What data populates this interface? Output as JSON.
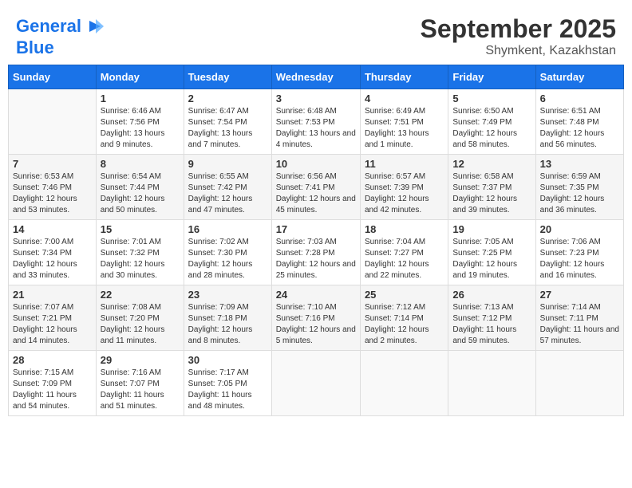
{
  "header": {
    "logo_line1": "General",
    "logo_line2": "Blue",
    "month": "September 2025",
    "location": "Shymkent, Kazakhstan"
  },
  "weekdays": [
    "Sunday",
    "Monday",
    "Tuesday",
    "Wednesday",
    "Thursday",
    "Friday",
    "Saturday"
  ],
  "weeks": [
    [
      {
        "day": "",
        "sunrise": "",
        "sunset": "",
        "daylight": ""
      },
      {
        "day": "1",
        "sunrise": "Sunrise: 6:46 AM",
        "sunset": "Sunset: 7:56 PM",
        "daylight": "Daylight: 13 hours and 9 minutes."
      },
      {
        "day": "2",
        "sunrise": "Sunrise: 6:47 AM",
        "sunset": "Sunset: 7:54 PM",
        "daylight": "Daylight: 13 hours and 7 minutes."
      },
      {
        "day": "3",
        "sunrise": "Sunrise: 6:48 AM",
        "sunset": "Sunset: 7:53 PM",
        "daylight": "Daylight: 13 hours and 4 minutes."
      },
      {
        "day": "4",
        "sunrise": "Sunrise: 6:49 AM",
        "sunset": "Sunset: 7:51 PM",
        "daylight": "Daylight: 13 hours and 1 minute."
      },
      {
        "day": "5",
        "sunrise": "Sunrise: 6:50 AM",
        "sunset": "Sunset: 7:49 PM",
        "daylight": "Daylight: 12 hours and 58 minutes."
      },
      {
        "day": "6",
        "sunrise": "Sunrise: 6:51 AM",
        "sunset": "Sunset: 7:48 PM",
        "daylight": "Daylight: 12 hours and 56 minutes."
      }
    ],
    [
      {
        "day": "7",
        "sunrise": "Sunrise: 6:53 AM",
        "sunset": "Sunset: 7:46 PM",
        "daylight": "Daylight: 12 hours and 53 minutes."
      },
      {
        "day": "8",
        "sunrise": "Sunrise: 6:54 AM",
        "sunset": "Sunset: 7:44 PM",
        "daylight": "Daylight: 12 hours and 50 minutes."
      },
      {
        "day": "9",
        "sunrise": "Sunrise: 6:55 AM",
        "sunset": "Sunset: 7:42 PM",
        "daylight": "Daylight: 12 hours and 47 minutes."
      },
      {
        "day": "10",
        "sunrise": "Sunrise: 6:56 AM",
        "sunset": "Sunset: 7:41 PM",
        "daylight": "Daylight: 12 hours and 45 minutes."
      },
      {
        "day": "11",
        "sunrise": "Sunrise: 6:57 AM",
        "sunset": "Sunset: 7:39 PM",
        "daylight": "Daylight: 12 hours and 42 minutes."
      },
      {
        "day": "12",
        "sunrise": "Sunrise: 6:58 AM",
        "sunset": "Sunset: 7:37 PM",
        "daylight": "Daylight: 12 hours and 39 minutes."
      },
      {
        "day": "13",
        "sunrise": "Sunrise: 6:59 AM",
        "sunset": "Sunset: 7:35 PM",
        "daylight": "Daylight: 12 hours and 36 minutes."
      }
    ],
    [
      {
        "day": "14",
        "sunrise": "Sunrise: 7:00 AM",
        "sunset": "Sunset: 7:34 PM",
        "daylight": "Daylight: 12 hours and 33 minutes."
      },
      {
        "day": "15",
        "sunrise": "Sunrise: 7:01 AM",
        "sunset": "Sunset: 7:32 PM",
        "daylight": "Daylight: 12 hours and 30 minutes."
      },
      {
        "day": "16",
        "sunrise": "Sunrise: 7:02 AM",
        "sunset": "Sunset: 7:30 PM",
        "daylight": "Daylight: 12 hours and 28 minutes."
      },
      {
        "day": "17",
        "sunrise": "Sunrise: 7:03 AM",
        "sunset": "Sunset: 7:28 PM",
        "daylight": "Daylight: 12 hours and 25 minutes."
      },
      {
        "day": "18",
        "sunrise": "Sunrise: 7:04 AM",
        "sunset": "Sunset: 7:27 PM",
        "daylight": "Daylight: 12 hours and 22 minutes."
      },
      {
        "day": "19",
        "sunrise": "Sunrise: 7:05 AM",
        "sunset": "Sunset: 7:25 PM",
        "daylight": "Daylight: 12 hours and 19 minutes."
      },
      {
        "day": "20",
        "sunrise": "Sunrise: 7:06 AM",
        "sunset": "Sunset: 7:23 PM",
        "daylight": "Daylight: 12 hours and 16 minutes."
      }
    ],
    [
      {
        "day": "21",
        "sunrise": "Sunrise: 7:07 AM",
        "sunset": "Sunset: 7:21 PM",
        "daylight": "Daylight: 12 hours and 14 minutes."
      },
      {
        "day": "22",
        "sunrise": "Sunrise: 7:08 AM",
        "sunset": "Sunset: 7:20 PM",
        "daylight": "Daylight: 12 hours and 11 minutes."
      },
      {
        "day": "23",
        "sunrise": "Sunrise: 7:09 AM",
        "sunset": "Sunset: 7:18 PM",
        "daylight": "Daylight: 12 hours and 8 minutes."
      },
      {
        "day": "24",
        "sunrise": "Sunrise: 7:10 AM",
        "sunset": "Sunset: 7:16 PM",
        "daylight": "Daylight: 12 hours and 5 minutes."
      },
      {
        "day": "25",
        "sunrise": "Sunrise: 7:12 AM",
        "sunset": "Sunset: 7:14 PM",
        "daylight": "Daylight: 12 hours and 2 minutes."
      },
      {
        "day": "26",
        "sunrise": "Sunrise: 7:13 AM",
        "sunset": "Sunset: 7:12 PM",
        "daylight": "Daylight: 11 hours and 59 minutes."
      },
      {
        "day": "27",
        "sunrise": "Sunrise: 7:14 AM",
        "sunset": "Sunset: 7:11 PM",
        "daylight": "Daylight: 11 hours and 57 minutes."
      }
    ],
    [
      {
        "day": "28",
        "sunrise": "Sunrise: 7:15 AM",
        "sunset": "Sunset: 7:09 PM",
        "daylight": "Daylight: 11 hours and 54 minutes."
      },
      {
        "day": "29",
        "sunrise": "Sunrise: 7:16 AM",
        "sunset": "Sunset: 7:07 PM",
        "daylight": "Daylight: 11 hours and 51 minutes."
      },
      {
        "day": "30",
        "sunrise": "Sunrise: 7:17 AM",
        "sunset": "Sunset: 7:05 PM",
        "daylight": "Daylight: 11 hours and 48 minutes."
      },
      {
        "day": "",
        "sunrise": "",
        "sunset": "",
        "daylight": ""
      },
      {
        "day": "",
        "sunrise": "",
        "sunset": "",
        "daylight": ""
      },
      {
        "day": "",
        "sunrise": "",
        "sunset": "",
        "daylight": ""
      },
      {
        "day": "",
        "sunrise": "",
        "sunset": "",
        "daylight": ""
      }
    ]
  ]
}
